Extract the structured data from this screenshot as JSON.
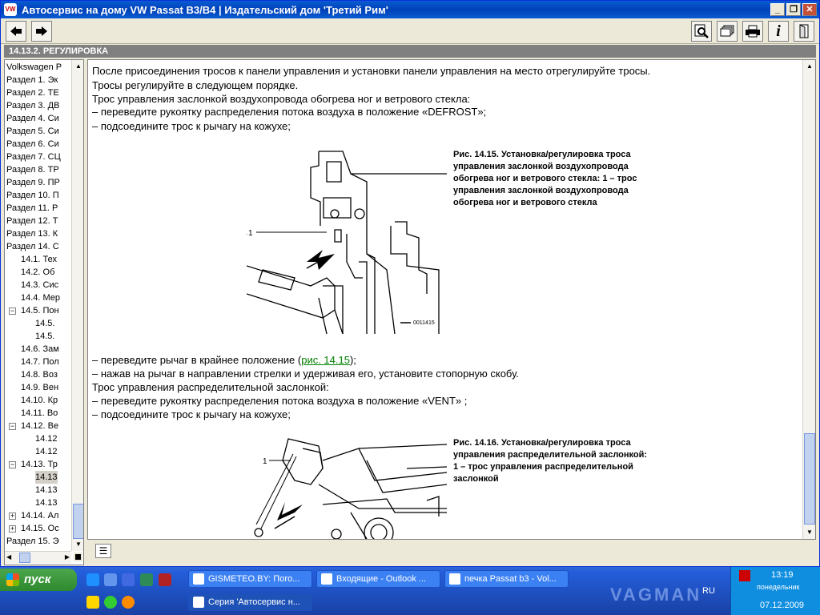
{
  "window": {
    "title": "Автосервис на дому VW Passat B3/B4 | Издательский дом 'Третий Рим'",
    "minimize": "_",
    "restore": "❐",
    "close": "✕"
  },
  "toolbar": {
    "back_icon": "arrow-left-icon",
    "forward_icon": "arrow-right-icon",
    "search_icon": "magnifier-icon",
    "bookmarks_icon": "folders-icon",
    "print_icon": "printer-icon",
    "info_icon": "info-icon",
    "exit_icon": "door-icon",
    "info_label": "i"
  },
  "section": {
    "title": "14.13.2. РЕГУЛИРОВКА"
  },
  "tree": {
    "items": [
      {
        "label": "Volkswagen P"
      },
      {
        "label": "Раздел 1. Эк"
      },
      {
        "label": "Раздел 2. ТЕ"
      },
      {
        "label": "Раздел 3. ДВ"
      },
      {
        "label": "Раздел 4. Си"
      },
      {
        "label": "Раздел 5. Си"
      },
      {
        "label": "Раздел 6. Си"
      },
      {
        "label": "Раздел 7. СЦ"
      },
      {
        "label": "Раздел 8. ТР"
      },
      {
        "label": "Раздел 9. ПР"
      },
      {
        "label": "Раздел 10. П"
      },
      {
        "label": "Раздел 11. Р"
      },
      {
        "label": "Раздел 12. Т"
      },
      {
        "label": "Раздел 13. К"
      },
      {
        "label": "Раздел 14. С"
      },
      {
        "label": "14.1. Тех"
      },
      {
        "label": "14.2. Об"
      },
      {
        "label": "14.3. Сис"
      },
      {
        "label": "14.4. Мер"
      },
      {
        "label": "14.5. Пон"
      },
      {
        "label": "14.5."
      },
      {
        "label": "14.5."
      },
      {
        "label": "14.6. Зам"
      },
      {
        "label": "14.7. Пол"
      },
      {
        "label": "14.8. Воз"
      },
      {
        "label": "14.9. Вен"
      },
      {
        "label": "14.10. Кр"
      },
      {
        "label": "14.11. Во"
      },
      {
        "label": "14.12. Ве"
      },
      {
        "label": "14.12"
      },
      {
        "label": "14.12"
      },
      {
        "label": "14.13. Тр"
      },
      {
        "label": "14.13"
      },
      {
        "label": "14.13"
      },
      {
        "label": "14.13"
      },
      {
        "label": "14.14. Ал"
      },
      {
        "label": "14.15. Ос"
      },
      {
        "label": "Раздел 15. Э"
      }
    ]
  },
  "content": {
    "paragraphs": [
      "После присоединения тросов к панели управления и установки панели управления на место отрегулируйте тросы.",
      "Тросы регулируйте в следующем порядке.",
      "Трос управления заслонкой воздухопровода обогрева ног и ветрового стекла:",
      "– переведите рукоятку распределения потока воздуха в положение «DEFROST»;",
      "– подсоедините трос к рычагу на кожухе;"
    ],
    "fig1_caption": "Рис. 14.15. Установка/регулировка троса управления заслонкой воздухопровода обогрева ног и ветрового стекла: 1 – трос управления заслонкой воздухопровода обогрева ног и ветрового стекла",
    "fig1_label": "1",
    "fig1_code": "0011415",
    "p_move_lever_a": "– переведите рычаг в крайнее положение (",
    "p_move_lever_link": "рис. 14.15",
    "p_move_lever_b": ");",
    "paragraphs2": [
      "– нажав на рычаг в направлении стрелки и удерживая его, установите стопорную скобу.",
      "Трос управления распределительной заслонкой:",
      "– переведите рукоятку распределения потока воздуха в положение «VENT» ;",
      "– подсоедините трос к рычагу на кожухе;"
    ],
    "fig2_caption": "Рис. 14.16. Установка/регулировка троса управления распределительной заслонкой: 1 – трос управления распределительной заслонкой",
    "fig2_label": "1"
  },
  "taskbar": {
    "start_label": "пуск",
    "tasks_row1": [
      {
        "label": "GISMETEO.BY: Пого..."
      },
      {
        "label": "Входящие - Outlook ..."
      },
      {
        "label": "печка Passat b3 - Vol..."
      }
    ],
    "tasks_row2": [
      {
        "label": "Серия 'Автосервис н..."
      }
    ],
    "lang": "RU",
    "time": "13:19",
    "day": "понедельник",
    "date": "07.12.2009"
  },
  "watermark": "VAGMAN"
}
